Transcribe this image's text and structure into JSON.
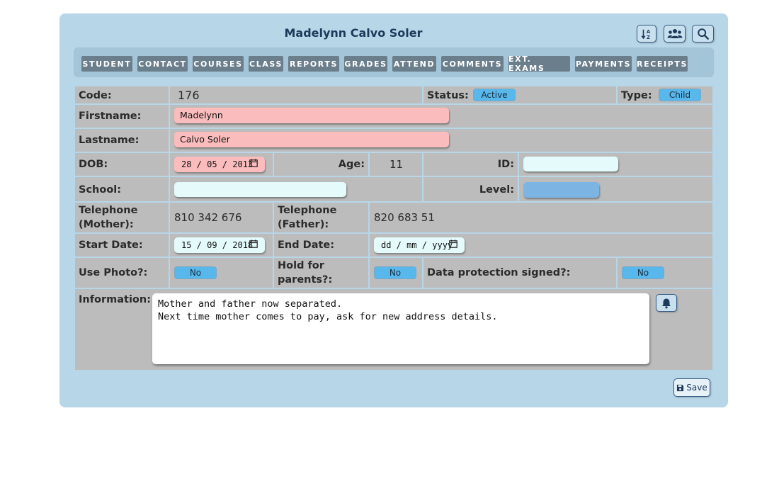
{
  "header": {
    "title": "Madelynn Calvo Soler",
    "icons": [
      "sort-az-icon",
      "group-icon",
      "search-icon"
    ]
  },
  "tabs": [
    "STUDENT",
    "CONTACT",
    "COURSES",
    "CLASS",
    "REPORTS",
    "GRADES",
    "ATTEND",
    "COMMENTS",
    "EXT. EXAMS",
    "PAYMENTS",
    "RECEIPTS"
  ],
  "form": {
    "code_label": "Code:",
    "code_value": "176",
    "status_label": "Status:",
    "status_value": "Active",
    "type_label": "Type:",
    "type_value": "Child",
    "firstname_label": "Firstname:",
    "firstname_value": "Madelynn",
    "lastname_label": "Lastname:",
    "lastname_value": "Calvo Soler",
    "dob_label": "DOB:",
    "dob_value": "28 / 05 / 2013",
    "age_label": "Age:",
    "age_value": "11",
    "id_label": "ID:",
    "id_value": "",
    "school_label": "School:",
    "school_value": "",
    "level_label": "Level:",
    "level_value": "",
    "tel_mother_label": "Telephone (Mother):",
    "tel_mother_value": "810 342 676",
    "tel_father_label": "Telephone (Father):",
    "tel_father_value": "820 683 51",
    "start_date_label": "Start Date:",
    "start_date_value": "15 / 09 / 2018",
    "end_date_label": "End Date:",
    "end_date_placeholder": "dd / mm / yyyy",
    "use_photo_label": "Use Photo?:",
    "use_photo_value": "No",
    "hold_label": "Hold for parents?:",
    "hold_value": "No",
    "data_protection_label": "Data protection signed?:",
    "data_protection_value": "No",
    "information_label": "Information:",
    "information_value": "Mother and father now separated.\nNext time mother comes to pay, ask for new address details."
  },
  "footer": {
    "save_label": "Save"
  },
  "colors": {
    "panel": "#b7d6e8",
    "tab": "#6b7e8c",
    "cell": "#bcbcbc",
    "pink_input": "#fbbcbd",
    "cyan_input": "#e4fafb",
    "pill": "#58b8ec"
  }
}
